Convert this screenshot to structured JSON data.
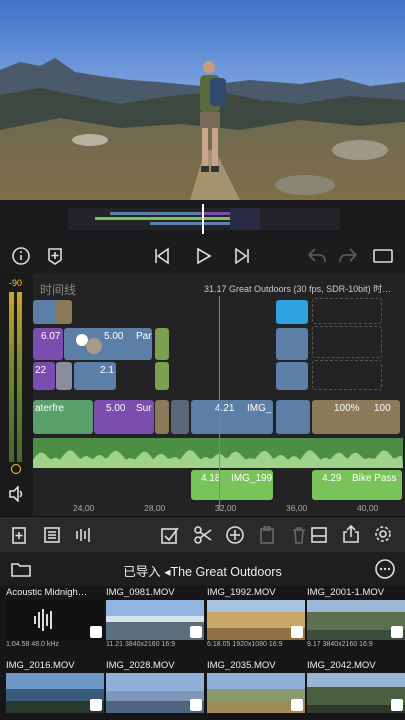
{
  "colors": {
    "accent": "#ffcc33",
    "playhead": "#4a90d9",
    "video_clip": "#5c7fa8",
    "title_clip": "#7b4dae",
    "audio_clip": "#79c35b"
  },
  "meter": {
    "peak_label": "-90"
  },
  "timeline": {
    "label": "时间线",
    "info": "31.17  Great Outdoors (30 fps, SDR-10bit) 时…",
    "ruler": [
      "24,00",
      "28,00",
      "32,00",
      "36,00",
      "40,00"
    ],
    "clips": {
      "c1_label": "6.07",
      "c2_label": "5.00",
      "c2_name": "Par",
      "c3_label": "22",
      "c4_label": "2.1",
      "main_a_name": "aterfre",
      "main_b_label": "5.00",
      "main_b_name": "Sur",
      "main_c_label": "4.21",
      "main_c_name": "IMG_",
      "main_d_label": "100%",
      "main_d_label2": "100",
      "audio1_label": "4.18",
      "audio1_name": "IMG_199",
      "audio2_label": "4.29",
      "audio2_name": "Bike Pass"
    }
  },
  "browser": {
    "title": "已导入 ◂The Great Outdoors",
    "items": [
      {
        "name": "Acoustic Midnigh…",
        "meta": "1:04.58  48.0 kHz",
        "kind": "audio"
      },
      {
        "name": "IMG_0981.MOV",
        "meta": "11.21  3840x2160  16:9",
        "kind": "video",
        "tone": "mountain-snow"
      },
      {
        "name": "IMG_1992.MOV",
        "meta": "6:18.05  1920x1080  16:9",
        "kind": "video",
        "tone": "autumn"
      },
      {
        "name": "IMG_2001-1.MOV",
        "meta": "9.17  3840x2160  16:9",
        "kind": "video",
        "tone": "valley"
      },
      {
        "name": "IMG_2016.MOV",
        "meta": "",
        "kind": "video",
        "tone": "lake"
      },
      {
        "name": "IMG_2028.MOV",
        "meta": "",
        "kind": "video",
        "tone": "blue-ridge"
      },
      {
        "name": "IMG_2035.MOV",
        "meta": "",
        "kind": "video",
        "tone": "meadow"
      },
      {
        "name": "IMG_2042.MOV",
        "meta": "",
        "kind": "video",
        "tone": "trees"
      }
    ]
  },
  "icons": [
    "info-icon",
    "add-marker-icon",
    "skip-back-icon",
    "play-icon",
    "skip-forward-icon",
    "undo-icon",
    "redo-icon",
    "fullscreen-icon"
  ]
}
